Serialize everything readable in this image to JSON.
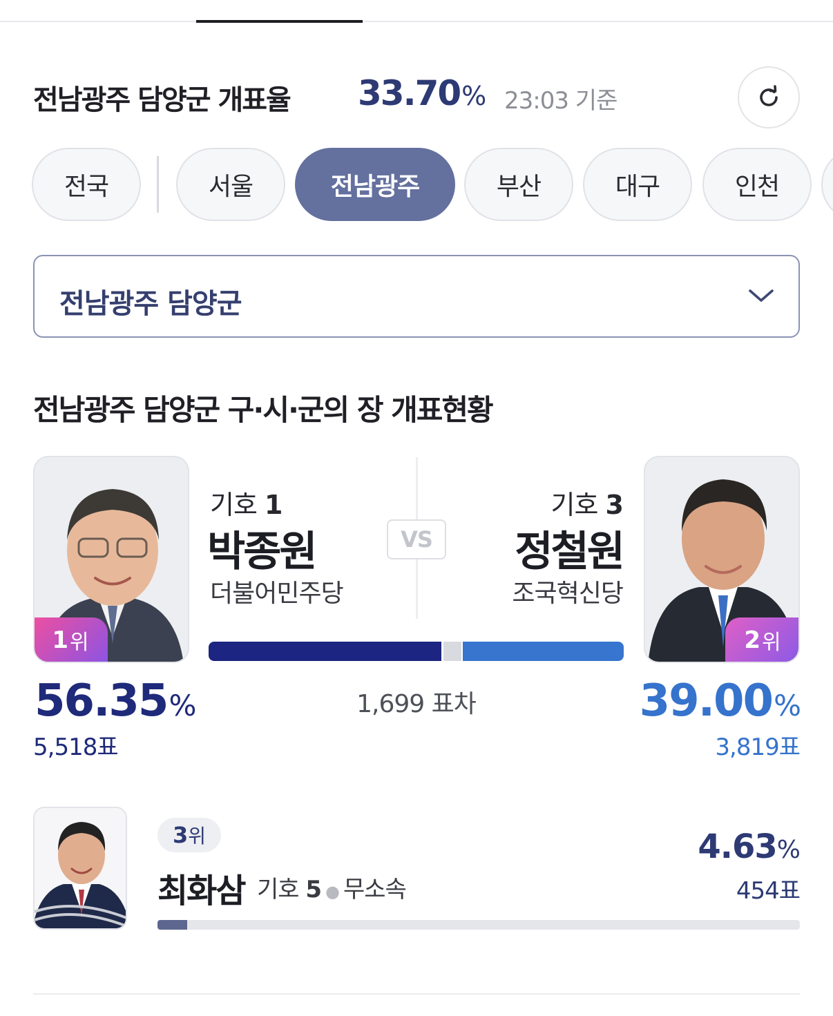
{
  "header": {
    "title": "전남광주 담양군 개표율",
    "rate_value": "33.70",
    "rate_unit": "%",
    "time_text": "23:03 기준",
    "refresh_icon": "refresh-icon"
  },
  "regions": {
    "items": [
      "전국",
      "서울",
      "전남광주",
      "부산",
      "대구",
      "인천"
    ],
    "active": "전남광주"
  },
  "district_select": {
    "value": "전남광주 담양군",
    "icon": "chevron-down-icon"
  },
  "section": {
    "title": "전남광주 담양군 구·시·군의 장 개표현황"
  },
  "colors": {
    "first": "#1c2581",
    "second": "#3775cf",
    "third": "#5d668f",
    "accent": "#64709e"
  },
  "candidates": [
    {
      "rank_num": "1",
      "rank_unit": "위",
      "number_label": "기호",
      "number": "1",
      "name": "박종원",
      "party": "더불어민주당",
      "pct_value": "56.35",
      "pct_unit": "%",
      "votes": "5,518표",
      "share": 56.35
    },
    {
      "rank_num": "2",
      "rank_unit": "위",
      "number_label": "기호",
      "number": "3",
      "name": "정철원",
      "party": "조국혁신당",
      "pct_value": "39.00",
      "pct_unit": "%",
      "votes": "3,819표",
      "share": 39.0
    },
    {
      "rank_num": "3",
      "rank_unit": "위",
      "number_label": "기호",
      "number": "5",
      "name": "최화삼",
      "party": "무소속",
      "pct_value": "4.63",
      "pct_unit": "%",
      "votes": "454표",
      "share": 4.63
    }
  ],
  "vs_label": "VS",
  "margin_text": "1,699 표차"
}
